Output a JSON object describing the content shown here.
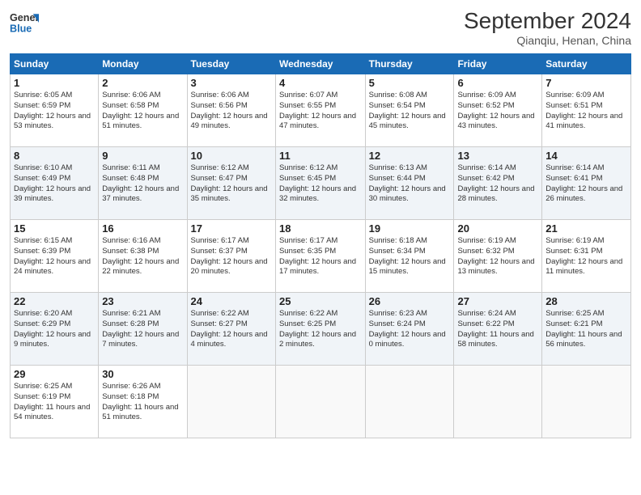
{
  "logo": {
    "line1": "General",
    "line2": "Blue"
  },
  "header": {
    "month_title": "September 2024",
    "subtitle": "Qianqiu, Henan, China"
  },
  "days_of_week": [
    "Sunday",
    "Monday",
    "Tuesday",
    "Wednesday",
    "Thursday",
    "Friday",
    "Saturday"
  ],
  "weeks": [
    [
      {
        "day": "1",
        "sunrise": "6:05 AM",
        "sunset": "6:59 PM",
        "daylight": "12 hours and 53 minutes."
      },
      {
        "day": "2",
        "sunrise": "6:06 AM",
        "sunset": "6:58 PM",
        "daylight": "12 hours and 51 minutes."
      },
      {
        "day": "3",
        "sunrise": "6:06 AM",
        "sunset": "6:56 PM",
        "daylight": "12 hours and 49 minutes."
      },
      {
        "day": "4",
        "sunrise": "6:07 AM",
        "sunset": "6:55 PM",
        "daylight": "12 hours and 47 minutes."
      },
      {
        "day": "5",
        "sunrise": "6:08 AM",
        "sunset": "6:54 PM",
        "daylight": "12 hours and 45 minutes."
      },
      {
        "day": "6",
        "sunrise": "6:09 AM",
        "sunset": "6:52 PM",
        "daylight": "12 hours and 43 minutes."
      },
      {
        "day": "7",
        "sunrise": "6:09 AM",
        "sunset": "6:51 PM",
        "daylight": "12 hours and 41 minutes."
      }
    ],
    [
      {
        "day": "8",
        "sunrise": "6:10 AM",
        "sunset": "6:49 PM",
        "daylight": "12 hours and 39 minutes."
      },
      {
        "day": "9",
        "sunrise": "6:11 AM",
        "sunset": "6:48 PM",
        "daylight": "12 hours and 37 minutes."
      },
      {
        "day": "10",
        "sunrise": "6:12 AM",
        "sunset": "6:47 PM",
        "daylight": "12 hours and 35 minutes."
      },
      {
        "day": "11",
        "sunrise": "6:12 AM",
        "sunset": "6:45 PM",
        "daylight": "12 hours and 32 minutes."
      },
      {
        "day": "12",
        "sunrise": "6:13 AM",
        "sunset": "6:44 PM",
        "daylight": "12 hours and 30 minutes."
      },
      {
        "day": "13",
        "sunrise": "6:14 AM",
        "sunset": "6:42 PM",
        "daylight": "12 hours and 28 minutes."
      },
      {
        "day": "14",
        "sunrise": "6:14 AM",
        "sunset": "6:41 PM",
        "daylight": "12 hours and 26 minutes."
      }
    ],
    [
      {
        "day": "15",
        "sunrise": "6:15 AM",
        "sunset": "6:39 PM",
        "daylight": "12 hours and 24 minutes."
      },
      {
        "day": "16",
        "sunrise": "6:16 AM",
        "sunset": "6:38 PM",
        "daylight": "12 hours and 22 minutes."
      },
      {
        "day": "17",
        "sunrise": "6:17 AM",
        "sunset": "6:37 PM",
        "daylight": "12 hours and 20 minutes."
      },
      {
        "day": "18",
        "sunrise": "6:17 AM",
        "sunset": "6:35 PM",
        "daylight": "12 hours and 17 minutes."
      },
      {
        "day": "19",
        "sunrise": "6:18 AM",
        "sunset": "6:34 PM",
        "daylight": "12 hours and 15 minutes."
      },
      {
        "day": "20",
        "sunrise": "6:19 AM",
        "sunset": "6:32 PM",
        "daylight": "12 hours and 13 minutes."
      },
      {
        "day": "21",
        "sunrise": "6:19 AM",
        "sunset": "6:31 PM",
        "daylight": "12 hours and 11 minutes."
      }
    ],
    [
      {
        "day": "22",
        "sunrise": "6:20 AM",
        "sunset": "6:29 PM",
        "daylight": "12 hours and 9 minutes."
      },
      {
        "day": "23",
        "sunrise": "6:21 AM",
        "sunset": "6:28 PM",
        "daylight": "12 hours and 7 minutes."
      },
      {
        "day": "24",
        "sunrise": "6:22 AM",
        "sunset": "6:27 PM",
        "daylight": "12 hours and 4 minutes."
      },
      {
        "day": "25",
        "sunrise": "6:22 AM",
        "sunset": "6:25 PM",
        "daylight": "12 hours and 2 minutes."
      },
      {
        "day": "26",
        "sunrise": "6:23 AM",
        "sunset": "6:24 PM",
        "daylight": "12 hours and 0 minutes."
      },
      {
        "day": "27",
        "sunrise": "6:24 AM",
        "sunset": "6:22 PM",
        "daylight": "11 hours and 58 minutes."
      },
      {
        "day": "28",
        "sunrise": "6:25 AM",
        "sunset": "6:21 PM",
        "daylight": "11 hours and 56 minutes."
      }
    ],
    [
      {
        "day": "29",
        "sunrise": "6:25 AM",
        "sunset": "6:19 PM",
        "daylight": "11 hours and 54 minutes."
      },
      {
        "day": "30",
        "sunrise": "6:26 AM",
        "sunset": "6:18 PM",
        "daylight": "11 hours and 51 minutes."
      },
      null,
      null,
      null,
      null,
      null
    ]
  ],
  "labels": {
    "sunrise_prefix": "Sunrise: ",
    "sunset_prefix": "Sunset: ",
    "daylight_prefix": "Daylight: "
  }
}
